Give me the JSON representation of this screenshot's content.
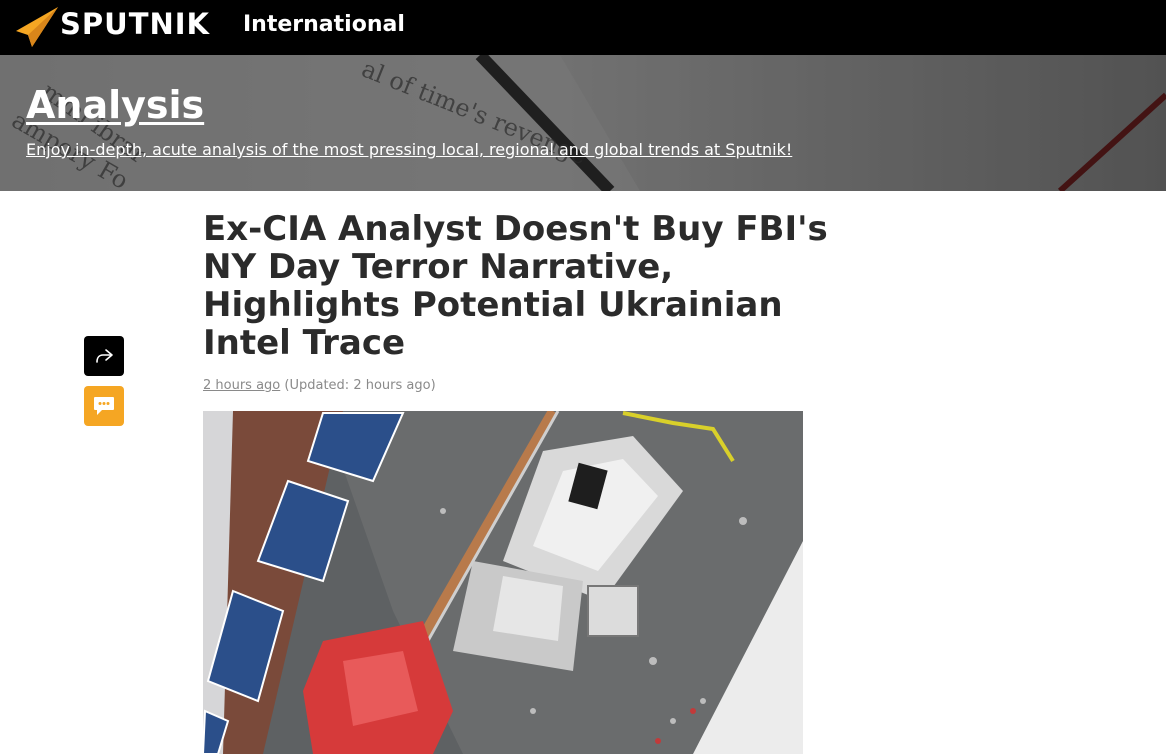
{
  "header": {
    "logo_text": "SPUTNIK",
    "edition": "International",
    "logo_color": "#f5a623"
  },
  "banner": {
    "title": "Analysis",
    "description": "Enjoy in-depth, acute analysis of the most pressing local, regional and global trends at Sputnik!"
  },
  "article": {
    "headline": "Ex-CIA Analyst Doesn't Buy FBI's NY Day Terror Narrative, Highlights Potential Ukrainian Intel Trace",
    "published": "2 hours ago",
    "updated": "(Updated: 2 hours ago)"
  },
  "actions": {
    "share_icon": "share-arrow-icon",
    "comment_icon": "chat-bubble-icon",
    "comment_color": "#f5a623"
  }
}
